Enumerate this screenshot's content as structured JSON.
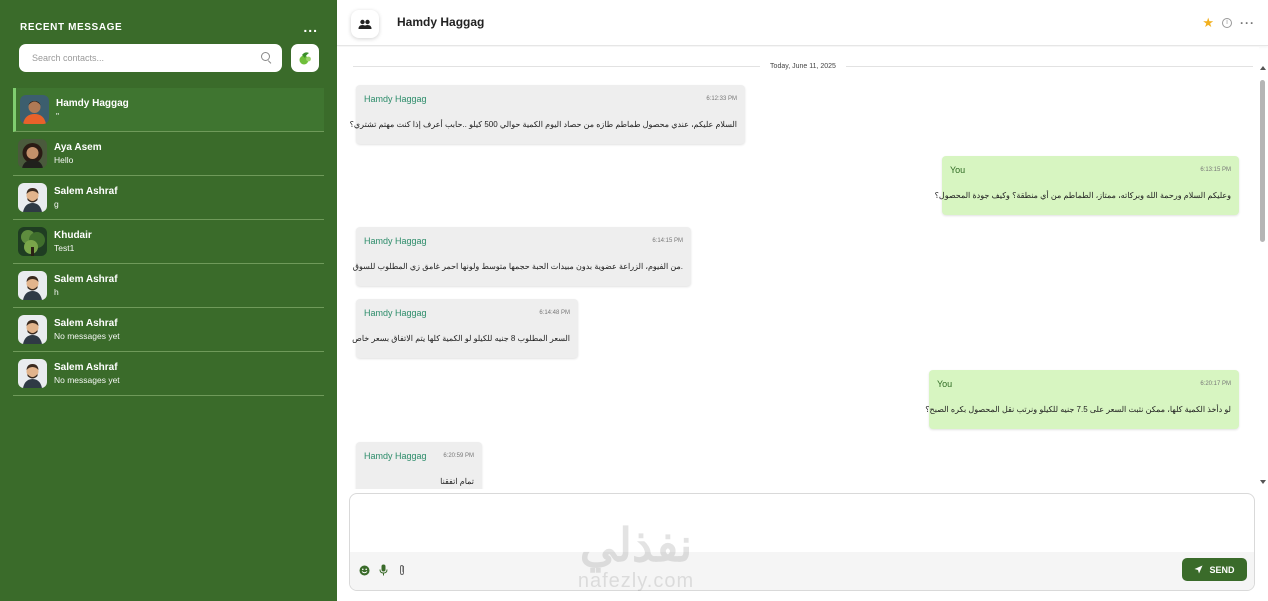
{
  "sidebar": {
    "title": "RECENT MESSAGE",
    "more_label": "...",
    "search_placeholder": "Search contacts...",
    "contacts": [
      {
        "name": "Hamdy Haggag",
        "last": "\"",
        "active": true
      },
      {
        "name": "Aya Asem",
        "last": "Hello"
      },
      {
        "name": "Salem Ashraf",
        "last": "g"
      },
      {
        "name": "Khudair",
        "last": "Test1"
      },
      {
        "name": "Salem Ashraf",
        "last": "h"
      },
      {
        "name": "Salem Ashraf",
        "last": "No messages yet"
      },
      {
        "name": "Salem Ashraf",
        "last": "No messages yet"
      }
    ]
  },
  "chat": {
    "title": "Hamdy Haggag",
    "date_separator": "Today, June 11, 2025",
    "messages": [
      {
        "sender": "Hamdy Haggag",
        "time": "6:12:33 PM",
        "text": "السلام عليكم، عندي محصول طماطم طازه من حصاد اليوم الكمية حوالي 500 كيلو ..حابب أعرف إذا كنت مهتم تشتري؟",
        "dir": "in"
      },
      {
        "sender": "You",
        "time": "6:13:15 PM",
        "text": "وعليكم السلام ورحمة الله وبركاته، ممتاز، الطماطم من أي منطقة؟ وكيف جودة المحصول؟",
        "dir": "out"
      },
      {
        "sender": "Hamdy Haggag",
        "time": "6:14:15 PM",
        "text": ".من الفيوم، الزراعة عضوية بدون مبيدات الحبة حجمها متوسط ولونها احمر غامق زي المطلوب للسوق",
        "dir": "in"
      },
      {
        "sender": "Hamdy Haggag",
        "time": "6:14:48 PM",
        "text": "السعر المطلوب 8 جنيه للكيلو لو الكمية كلها يتم الاتفاق بسعر خاص",
        "dir": "in"
      },
      {
        "sender": "You",
        "time": "6:20:17 PM",
        "text": "لو دأخذ الكمية كلها، ممكن نثبت السعر على 7.5 جنيه للكيلو ونرتب نقل المحصول بكره الصبح؟",
        "dir": "out"
      },
      {
        "sender": "Hamdy Haggag",
        "time": "6:20:59 PM",
        "text": "تمام اتفقنا",
        "dir": "in"
      }
    ]
  },
  "composer": {
    "placeholder": "",
    "send_label": "SEND"
  },
  "watermark": {
    "arabic": "نفذلي",
    "latin": "nafezly.com"
  },
  "colors": {
    "sidebar": "#3a6b2a",
    "out_bubble": "#d7f5c1",
    "in_bubble": "#eeeeee",
    "star": "#f2b01e",
    "sender": "#2c8c6a"
  }
}
